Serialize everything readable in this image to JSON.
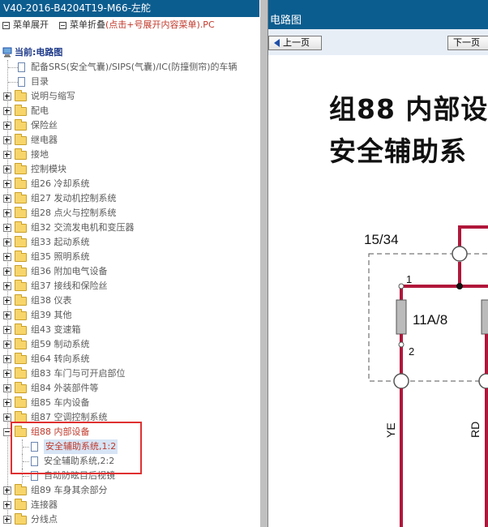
{
  "left_panel": {
    "title": "V40-2016-B4204T19-M66-左舵",
    "menu": {
      "expand_label": "菜单展开",
      "collapse_label": "菜单折叠",
      "hint": "(点击+号展开内容菜单)",
      "suffix": ".PC"
    },
    "tree": {
      "root_label": "当前:电路图",
      "items": [
        {
          "label": "配备SRS(安全气囊)/SIPS(气囊)/IC(防撞侧帘)的车辆",
          "kind": "doc"
        },
        {
          "label": "目录",
          "kind": "doc"
        },
        {
          "label": "说明与缩写",
          "kind": "folder"
        },
        {
          "label": "配电",
          "kind": "folder"
        },
        {
          "label": "保险丝",
          "kind": "folder"
        },
        {
          "label": "继电器",
          "kind": "folder"
        },
        {
          "label": "接地",
          "kind": "folder"
        },
        {
          "label": "控制模块",
          "kind": "folder"
        },
        {
          "label": "组26 冷却系统",
          "kind": "folder"
        },
        {
          "label": "组27 发动机控制系统",
          "kind": "folder"
        },
        {
          "label": "组28 点火与控制系统",
          "kind": "folder"
        },
        {
          "label": "组32 交流发电机和变压器",
          "kind": "folder"
        },
        {
          "label": "组33 起动系统",
          "kind": "folder"
        },
        {
          "label": "组35 照明系统",
          "kind": "folder"
        },
        {
          "label": "组36 附加电气设备",
          "kind": "folder"
        },
        {
          "label": "组37 接线和保险丝",
          "kind": "folder"
        },
        {
          "label": "组38 仪表",
          "kind": "folder"
        },
        {
          "label": "组39 其他",
          "kind": "folder"
        },
        {
          "label": "组43 变速箱",
          "kind": "folder"
        },
        {
          "label": "组59 制动系统",
          "kind": "folder"
        },
        {
          "label": "组64 转向系统",
          "kind": "folder"
        },
        {
          "label": "组83 车门与可开启部位",
          "kind": "folder"
        },
        {
          "label": "组84 外装部件等",
          "kind": "folder"
        },
        {
          "label": "组85 车内设备",
          "kind": "folder"
        },
        {
          "label": "组87 空调控制系统",
          "kind": "folder"
        },
        {
          "label": "组88 内部设备",
          "kind": "folder-open"
        },
        {
          "label": "安全辅助系统,1:2",
          "kind": "subdoc-selected"
        },
        {
          "label": "安全辅助系统,2:2",
          "kind": "subdoc"
        },
        {
          "label": "自动防眩目后视镜",
          "kind": "subdoc"
        },
        {
          "label": "组89 车身其余部分",
          "kind": "folder"
        },
        {
          "label": "连接器",
          "kind": "folder"
        },
        {
          "label": "分线点",
          "kind": "folder"
        }
      ]
    }
  },
  "right_panel": {
    "title": "电路图",
    "prev_label": "上一页",
    "next_label": "下一页",
    "diagram": {
      "heading_line1": "组88 内部设",
      "heading_line2": "安全辅助系",
      "connector_label": "15/34",
      "pin1": "1",
      "pin2": "2",
      "fuse_label": "11A/8",
      "wire_left": "YE",
      "wire_right": "RD"
    }
  },
  "colors": {
    "title_bar": "#0c5d8f",
    "wire": "#b0173a",
    "highlight": "#e03030"
  }
}
